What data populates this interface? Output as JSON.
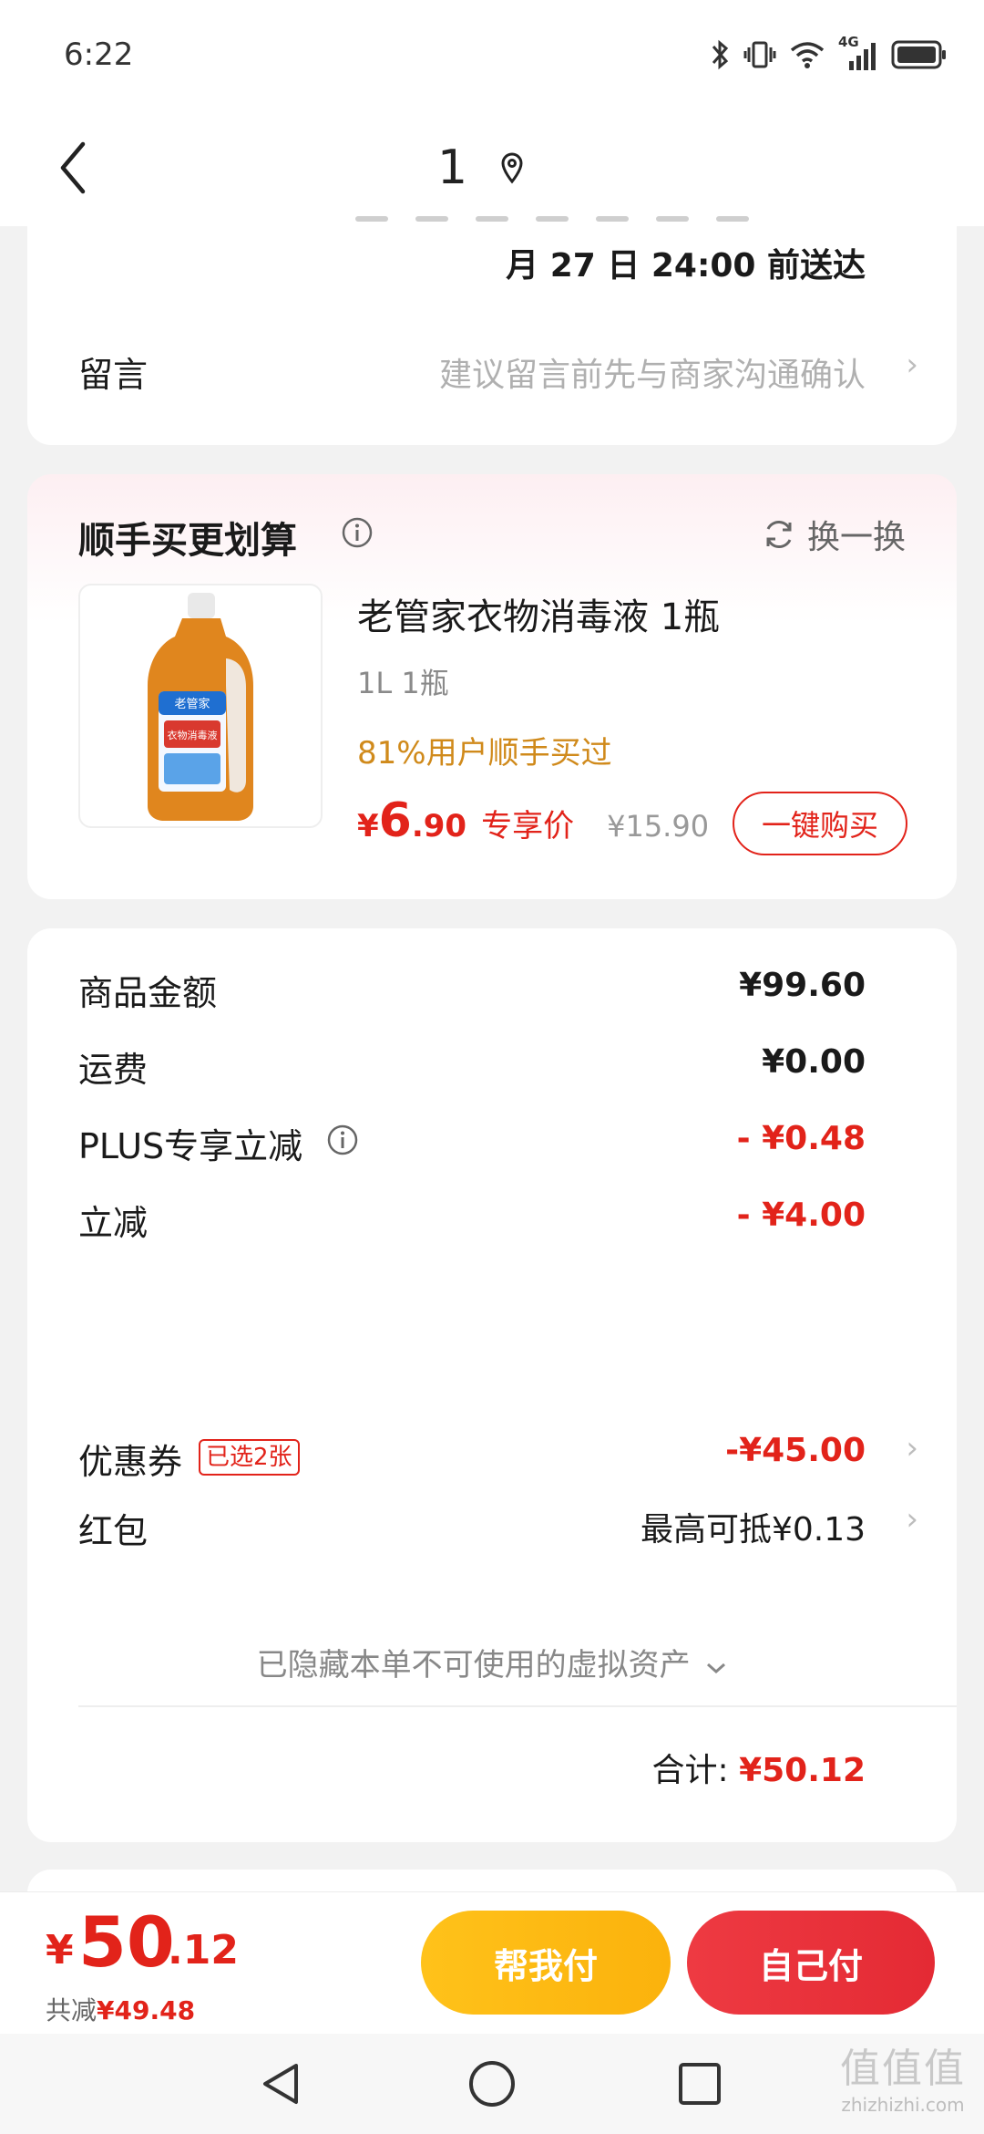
{
  "status_bar": {
    "time": "6:22",
    "network": "4G"
  },
  "nav": {
    "title": "1"
  },
  "delivery": {
    "text": "月 27 日 24:00 前送达"
  },
  "message": {
    "label": "留言",
    "placeholder": "建议留言前先与商家沟通确认"
  },
  "recommend": {
    "title": "顺手买更划算",
    "swap_label": "换一换",
    "product": {
      "name": "老管家衣物消毒液 1瓶",
      "spec": "1L 1瓶",
      "social_proof": "81%用户顺手买过",
      "price_symbol": "¥",
      "price_int": "6",
      "price_dec": ".90",
      "price_tag": "专享价",
      "original_price": "¥15.90",
      "buy_label": "一键购买",
      "bottle_label_brand": "老管家",
      "bottle_label_name": "衣物消毒液"
    }
  },
  "summary": {
    "rows": [
      {
        "label": "商品金额",
        "value": "¥99.60"
      },
      {
        "label": "运费",
        "value": "¥0.00"
      },
      {
        "label": "PLUS专享立减",
        "value": "- ¥0.48"
      },
      {
        "label": "立减",
        "value": "- ¥4.00"
      },
      {
        "label": "优惠券",
        "badge": "已选2张",
        "value": "-¥45.00"
      },
      {
        "label": "红包",
        "value": "最高可抵¥0.13"
      }
    ],
    "hidden_assets": "已隐藏本单不可使用的虚拟资产",
    "total_label": "合计:",
    "total_value": "¥50.12"
  },
  "bottom_bar": {
    "pay_symbol": "¥",
    "pay_int": "50",
    "pay_dec": ".12",
    "saved_label": "共减",
    "saved_value": "¥49.48",
    "help_pay_label": "帮我付",
    "self_pay_label": "自己付"
  },
  "watermark": {
    "glyphs": "值值值",
    "site": "zhizhizhi.com"
  },
  "colors": {
    "accent_red": "#e2231a",
    "gold": "#d08a1b",
    "yellow_button": "#ffc21a"
  }
}
